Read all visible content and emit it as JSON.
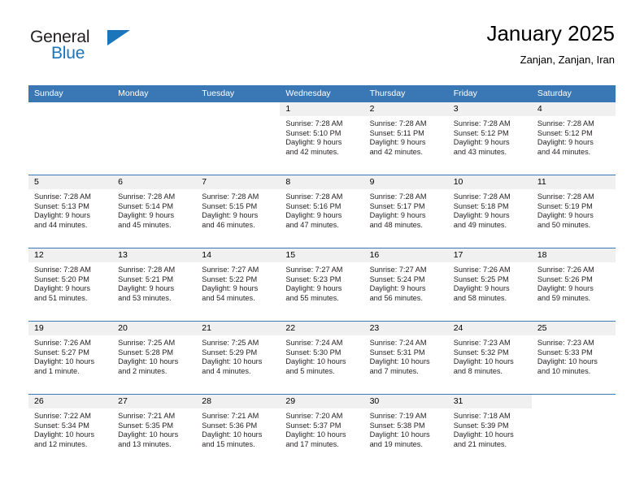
{
  "brand": {
    "name_top": "General",
    "name_bottom": "Blue",
    "accent_color": "#1b75bb",
    "text_color": "#231f20"
  },
  "header": {
    "title": "January 2025",
    "subtitle": "Zanjan, Zanjan, Iran"
  },
  "theme": {
    "header_bar_color": "#3a78b5",
    "day_band_color": "#f0f0f0",
    "grid_line_color": "#3a78b5",
    "page_background": "#ffffff"
  },
  "calendar": {
    "weekday_headers": [
      "Sunday",
      "Monday",
      "Tuesday",
      "Wednesday",
      "Thursday",
      "Friday",
      "Saturday"
    ],
    "weeks": [
      [
        {
          "day": "",
          "blank": true,
          "lines": []
        },
        {
          "day": "",
          "blank": true,
          "lines": []
        },
        {
          "day": "",
          "blank": true,
          "lines": []
        },
        {
          "day": "1",
          "lines": [
            "Sunrise: 7:28 AM",
            "Sunset: 5:10 PM",
            "Daylight: 9 hours",
            "and 42 minutes."
          ]
        },
        {
          "day": "2",
          "lines": [
            "Sunrise: 7:28 AM",
            "Sunset: 5:11 PM",
            "Daylight: 9 hours",
            "and 42 minutes."
          ]
        },
        {
          "day": "3",
          "lines": [
            "Sunrise: 7:28 AM",
            "Sunset: 5:12 PM",
            "Daylight: 9 hours",
            "and 43 minutes."
          ]
        },
        {
          "day": "4",
          "lines": [
            "Sunrise: 7:28 AM",
            "Sunset: 5:12 PM",
            "Daylight: 9 hours",
            "and 44 minutes."
          ]
        }
      ],
      [
        {
          "day": "5",
          "lines": [
            "Sunrise: 7:28 AM",
            "Sunset: 5:13 PM",
            "Daylight: 9 hours",
            "and 44 minutes."
          ]
        },
        {
          "day": "6",
          "lines": [
            "Sunrise: 7:28 AM",
            "Sunset: 5:14 PM",
            "Daylight: 9 hours",
            "and 45 minutes."
          ]
        },
        {
          "day": "7",
          "lines": [
            "Sunrise: 7:28 AM",
            "Sunset: 5:15 PM",
            "Daylight: 9 hours",
            "and 46 minutes."
          ]
        },
        {
          "day": "8",
          "lines": [
            "Sunrise: 7:28 AM",
            "Sunset: 5:16 PM",
            "Daylight: 9 hours",
            "and 47 minutes."
          ]
        },
        {
          "day": "9",
          "lines": [
            "Sunrise: 7:28 AM",
            "Sunset: 5:17 PM",
            "Daylight: 9 hours",
            "and 48 minutes."
          ]
        },
        {
          "day": "10",
          "lines": [
            "Sunrise: 7:28 AM",
            "Sunset: 5:18 PM",
            "Daylight: 9 hours",
            "and 49 minutes."
          ]
        },
        {
          "day": "11",
          "lines": [
            "Sunrise: 7:28 AM",
            "Sunset: 5:19 PM",
            "Daylight: 9 hours",
            "and 50 minutes."
          ]
        }
      ],
      [
        {
          "day": "12",
          "lines": [
            "Sunrise: 7:28 AM",
            "Sunset: 5:20 PM",
            "Daylight: 9 hours",
            "and 51 minutes."
          ]
        },
        {
          "day": "13",
          "lines": [
            "Sunrise: 7:28 AM",
            "Sunset: 5:21 PM",
            "Daylight: 9 hours",
            "and 53 minutes."
          ]
        },
        {
          "day": "14",
          "lines": [
            "Sunrise: 7:27 AM",
            "Sunset: 5:22 PM",
            "Daylight: 9 hours",
            "and 54 minutes."
          ]
        },
        {
          "day": "15",
          "lines": [
            "Sunrise: 7:27 AM",
            "Sunset: 5:23 PM",
            "Daylight: 9 hours",
            "and 55 minutes."
          ]
        },
        {
          "day": "16",
          "lines": [
            "Sunrise: 7:27 AM",
            "Sunset: 5:24 PM",
            "Daylight: 9 hours",
            "and 56 minutes."
          ]
        },
        {
          "day": "17",
          "lines": [
            "Sunrise: 7:26 AM",
            "Sunset: 5:25 PM",
            "Daylight: 9 hours",
            "and 58 minutes."
          ]
        },
        {
          "day": "18",
          "lines": [
            "Sunrise: 7:26 AM",
            "Sunset: 5:26 PM",
            "Daylight: 9 hours",
            "and 59 minutes."
          ]
        }
      ],
      [
        {
          "day": "19",
          "lines": [
            "Sunrise: 7:26 AM",
            "Sunset: 5:27 PM",
            "Daylight: 10 hours",
            "and 1 minute."
          ]
        },
        {
          "day": "20",
          "lines": [
            "Sunrise: 7:25 AM",
            "Sunset: 5:28 PM",
            "Daylight: 10 hours",
            "and 2 minutes."
          ]
        },
        {
          "day": "21",
          "lines": [
            "Sunrise: 7:25 AM",
            "Sunset: 5:29 PM",
            "Daylight: 10 hours",
            "and 4 minutes."
          ]
        },
        {
          "day": "22",
          "lines": [
            "Sunrise: 7:24 AM",
            "Sunset: 5:30 PM",
            "Daylight: 10 hours",
            "and 5 minutes."
          ]
        },
        {
          "day": "23",
          "lines": [
            "Sunrise: 7:24 AM",
            "Sunset: 5:31 PM",
            "Daylight: 10 hours",
            "and 7 minutes."
          ]
        },
        {
          "day": "24",
          "lines": [
            "Sunrise: 7:23 AM",
            "Sunset: 5:32 PM",
            "Daylight: 10 hours",
            "and 8 minutes."
          ]
        },
        {
          "day": "25",
          "lines": [
            "Sunrise: 7:23 AM",
            "Sunset: 5:33 PM",
            "Daylight: 10 hours",
            "and 10 minutes."
          ]
        }
      ],
      [
        {
          "day": "26",
          "lines": [
            "Sunrise: 7:22 AM",
            "Sunset: 5:34 PM",
            "Daylight: 10 hours",
            "and 12 minutes."
          ]
        },
        {
          "day": "27",
          "lines": [
            "Sunrise: 7:21 AM",
            "Sunset: 5:35 PM",
            "Daylight: 10 hours",
            "and 13 minutes."
          ]
        },
        {
          "day": "28",
          "lines": [
            "Sunrise: 7:21 AM",
            "Sunset: 5:36 PM",
            "Daylight: 10 hours",
            "and 15 minutes."
          ]
        },
        {
          "day": "29",
          "lines": [
            "Sunrise: 7:20 AM",
            "Sunset: 5:37 PM",
            "Daylight: 10 hours",
            "and 17 minutes."
          ]
        },
        {
          "day": "30",
          "lines": [
            "Sunrise: 7:19 AM",
            "Sunset: 5:38 PM",
            "Daylight: 10 hours",
            "and 19 minutes."
          ]
        },
        {
          "day": "31",
          "lines": [
            "Sunrise: 7:18 AM",
            "Sunset: 5:39 PM",
            "Daylight: 10 hours",
            "and 21 minutes."
          ]
        },
        {
          "day": "",
          "blank": true,
          "lines": []
        }
      ]
    ]
  }
}
